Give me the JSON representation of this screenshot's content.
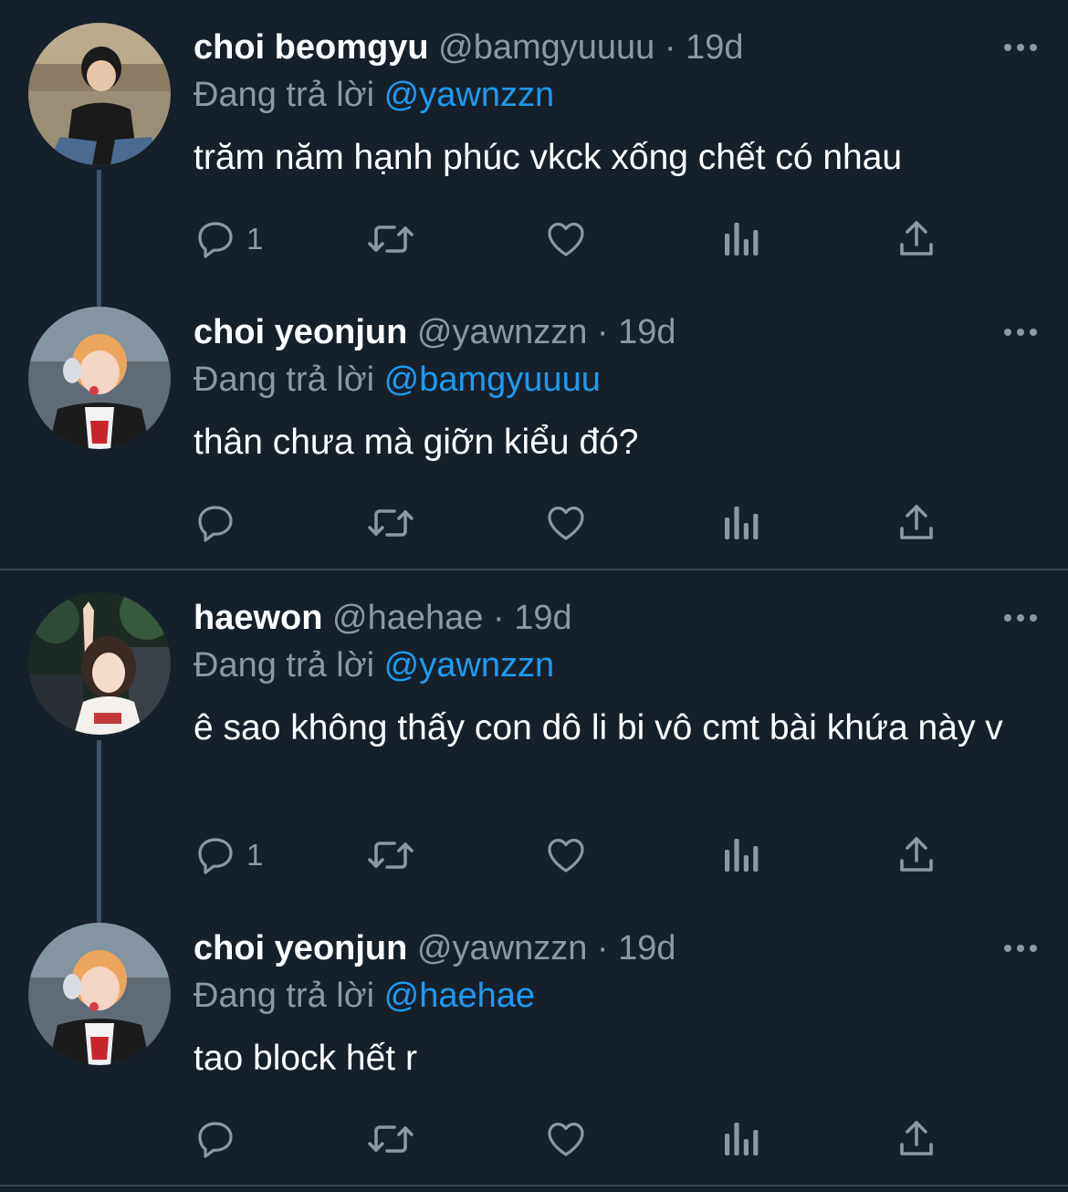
{
  "tweets": [
    {
      "name": "choi beomgyu",
      "handle": "@bamgyuuuu",
      "dot": "·",
      "time": "19d",
      "replying_label": "Đang trả lời",
      "replying_to": "@yawnzzn",
      "text": "trăm năm hạnh phúc vkck xống chết có nhau",
      "reply_count": "1"
    },
    {
      "name": "choi yeonjun",
      "handle": "@yawnzzn",
      "dot": "·",
      "time": "19d",
      "replying_label": "Đang trả lời",
      "replying_to": "@bamgyuuuu",
      "text": "thân chưa mà giỡn kiểu đó?",
      "reply_count": ""
    },
    {
      "name": "haewon",
      "handle": "@haehae",
      "dot": "·",
      "time": "19d",
      "replying_label": "Đang trả lời",
      "replying_to": "@yawnzzn",
      "text": "ê sao không thấy con dô li bi vô cmt bài khứa này v",
      "reply_count": "1"
    },
    {
      "name": "choi yeonjun",
      "handle": "@yawnzzn",
      "dot": "·",
      "time": "19d",
      "replying_label": "Đang trả lời",
      "replying_to": "@haehae",
      "text": "tao block hết r",
      "reply_count": ""
    }
  ],
  "icons": {
    "reply": "reply-icon",
    "retweet": "retweet-icon",
    "like": "heart-icon",
    "views": "views-icon",
    "share": "share-icon",
    "more": "more-dots-icon"
  },
  "colors": {
    "background": "#15202b",
    "secondary_text": "#8b98a5",
    "mention": "#1d9bf0",
    "thread_line": "#3d5466",
    "divider": "#38444d"
  }
}
